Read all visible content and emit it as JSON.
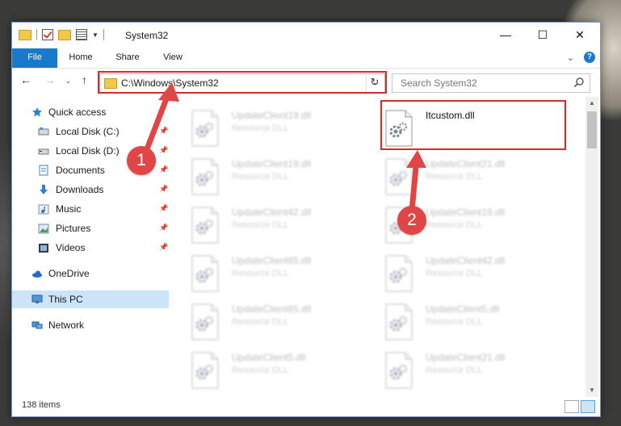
{
  "window": {
    "title": "System32",
    "controls": {
      "minimize": "—",
      "maximize": "☐",
      "close": "✕"
    }
  },
  "ribbon": {
    "tabs": [
      {
        "label": "File"
      },
      {
        "label": "Home"
      },
      {
        "label": "Share"
      },
      {
        "label": "View"
      }
    ]
  },
  "address": {
    "path": "C:\\Windows\\System32",
    "search_placeholder": "Search System32"
  },
  "sidebar": {
    "items": [
      {
        "label": "Quick access",
        "icon": "star-icon"
      },
      {
        "label": "Local Disk (C:)",
        "icon": "drive-icon"
      },
      {
        "label": "Local Disk (D:)",
        "icon": "drive-icon"
      },
      {
        "label": "Documents",
        "icon": "documents-icon"
      },
      {
        "label": "Downloads",
        "icon": "download-arrow-icon"
      },
      {
        "label": "Music",
        "icon": "music-icon"
      },
      {
        "label": "Pictures",
        "icon": "pictures-icon"
      },
      {
        "label": "Videos",
        "icon": "videos-icon"
      },
      {
        "label": "OneDrive",
        "icon": "cloud-icon"
      },
      {
        "label": "This PC",
        "icon": "monitor-icon"
      },
      {
        "label": "Network",
        "icon": "network-icon"
      }
    ]
  },
  "files": {
    "left": [
      {
        "name": "UpdateClient19.dll",
        "type": "Resource DLL"
      },
      {
        "name": "UpdateClient19.dll",
        "type": "Resource DLL"
      },
      {
        "name": "UpdateClient42.dll",
        "type": "Resource DLL"
      },
      {
        "name": "UpdateClient65.dll",
        "type": "Resource DLL"
      },
      {
        "name": "UpdateClient65.dll",
        "type": "Resource DLL"
      },
      {
        "name": "UpdateClient5.dll",
        "type": "Resource DLL"
      }
    ],
    "right": [
      {
        "name": "Itcustom.dll",
        "type": ""
      },
      {
        "name": "UpdateClient21.dll",
        "type": "Resource DLL"
      },
      {
        "name": "UpdateClient19.dll",
        "type": "Resource DLL"
      },
      {
        "name": "UpdateClient42.dll",
        "type": "Resource DLL"
      },
      {
        "name": "UpdateClient5.dll",
        "type": "Resource DLL"
      },
      {
        "name": "UpdateClient21.dll",
        "type": "Resource DLL"
      }
    ]
  },
  "status": {
    "item_count": "138 items"
  },
  "annotations": {
    "marker1": "1",
    "marker2": "2",
    "color": "#d42b2b"
  },
  "colors": {
    "accent": "#1979ca",
    "selection": "#cce4f7"
  }
}
